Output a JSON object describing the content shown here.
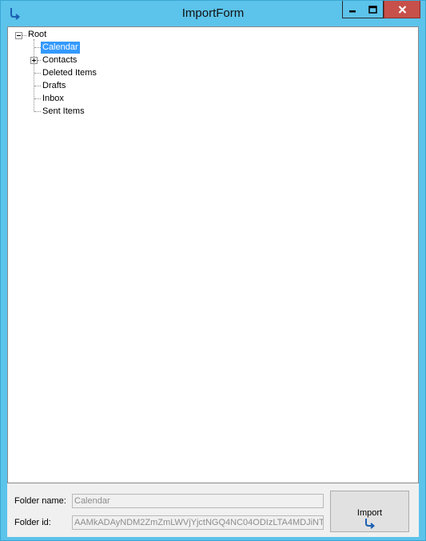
{
  "window": {
    "title": "ImportForm"
  },
  "tree": {
    "root": {
      "label": "Root"
    },
    "items": [
      {
        "label": "Calendar",
        "selected": true,
        "expandable": false
      },
      {
        "label": "Contacts",
        "selected": false,
        "expandable": true
      },
      {
        "label": "Deleted Items",
        "selected": false,
        "expandable": false
      },
      {
        "label": "Drafts",
        "selected": false,
        "expandable": false
      },
      {
        "label": "Inbox",
        "selected": false,
        "expandable": false
      },
      {
        "label": "Sent Items",
        "selected": false,
        "expandable": false
      }
    ]
  },
  "form": {
    "folder_name_label": "Folder name:",
    "folder_name_value": "Calendar",
    "folder_id_label": "Folder id:",
    "folder_id_value": "AAMkADAyNDM2ZmZmLWVjYjctNGQ4NC04ODIzLTA4MDJiNTY"
  },
  "buttons": {
    "import_label": "Import"
  },
  "icons": {
    "app": "import-arrow-icon",
    "minimize": "minimize-icon",
    "maximize": "maximize-icon",
    "close": "close-icon",
    "import": "import-arrow-icon"
  },
  "colors": {
    "titlebar": "#5cc3ea",
    "close_button": "#c7504a",
    "selection": "#3399ff",
    "icon_blue": "#1a5fb4"
  }
}
